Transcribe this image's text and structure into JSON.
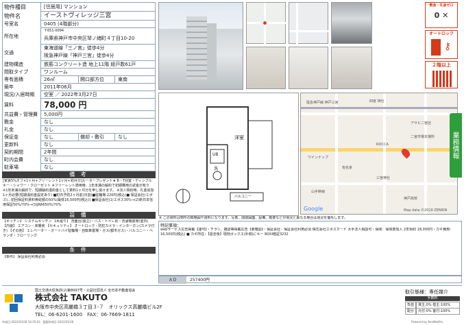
{
  "table": [
    {
      "label": "物件種目",
      "value": "[住居用] マンション"
    },
    {
      "label": "物件名",
      "value": "イーストヴィレッジ三宮"
    },
    {
      "label": "号室名",
      "value": "0405 (4階部分)"
    },
    {
      "label": "所在地",
      "value": "兵庫県神戸市中央区琴ノ緒町４丁目10-20",
      "postal": "〒651-0094"
    },
    {
      "label": "交通",
      "value": "東海道線「三ノ宮」徒歩4分",
      "value2": "阪急神戸線「神戸三宮」徒歩4分"
    },
    {
      "label": "建物構造",
      "value": "鉄筋コンクリート造 地上11階 総戸数61戸"
    },
    {
      "label": "間取タイプ",
      "value": "ワンルーム"
    },
    {
      "label": "専有面積",
      "value": "26㎡",
      "label2": "開口部方位",
      "value2": "東南"
    },
    {
      "label": "築年",
      "value": "2011年06月"
    },
    {
      "label": "現況/入居時期",
      "value": "空室 ／ 2022年3月27日"
    },
    {
      "label": "賃料",
      "value": "78,000 円"
    },
    {
      "label": "共益費・管理費",
      "value": "5,000円"
    },
    {
      "label": "敷金",
      "value": "なし"
    },
    {
      "label": "礼金",
      "value": "なし"
    },
    {
      "label": "保証金",
      "value": "なし",
      "label2": "償却・敷引",
      "value2": "なし"
    },
    {
      "label": "更新料",
      "value": "なし"
    },
    {
      "label": "契約期間",
      "value": "2年間"
    },
    {
      "label": "町内会費",
      "value": "なし"
    },
    {
      "label": "駐車場",
      "value": "なし"
    }
  ],
  "remarks_title": "備 考",
  "remarks": "[家賃5%オフ×1ヶ月+フリーレント1ヶ月+初月分]ルータープレゼント★ B・T別室・ディンプルキー・シャワー・クローゼット ※フリーレント適用時、1年未満の解約で初期費用の返金が有り ※1年未満の解約で、短期解約違約金として賃料1ヶ月分を申し受けます。 ※法人契約時、礼金追加1ヶ月必要(短期違約金設定あり) ■町内予防2ヶ月前(日割)■駐輪場:220円(税込)■ 保証会社(エポス)…初回保証料賃料等総額の50%(最低16,500円(税込)) ■保証会社(1)エポス30%→(2)新日本信用保証50%/70%→(3)JRA650%/70%",
  "facilities_title": "設 備",
  "facilities": "【キッチン】 システムキッチン 【水廻り】 洗面台(独立)・バス・トイレ別・洗濯機置場(室内) 【内装】 エアコン・床暖房 【セキュリティ】 オートロック・防犯カメラ・インターホン(カメラ付き) 【その他】 エレベーター・オートバイ駐輪場・自転車置場・ガス(都市ガス)・バルコニー・ベランダ・フローリング",
  "conditions_title": "条 件",
  "conditions": "【条件】 保証会社利用必須",
  "map_caption": "※ この資料は物件の概略図や資料になります。写真、間取図面、設備、概要などが現況と異なる場合は現況を優先します。",
  "floorplan_labels": {
    "room": "洋室",
    "ub": "UB",
    "wc": "洗",
    "balcony": "バルコニー"
  },
  "map_labels": [
    "阪急神戸線 神戸三宮",
    "四宮 神社",
    "ROCCA",
    "アサヒ二宮店",
    "二宮市場本場所",
    "ワインナップ",
    "有名家",
    "山手幹線",
    "三宮神社",
    "神戸高校",
    "Google",
    "Map data ©2019 ZENRIN"
  ],
  "side_tab": "業務情報",
  "badges": {
    "pets": "敷金・礼金ゼロ",
    "autolock": "オートロック",
    "floor": "２階以上"
  },
  "notes_title": "特記事項：",
  "notes": "webサービス広告掲載【諸可】・チラシ、雑誌等掲載広告【要確認】・保証会社：保証会社利用必須 株式会社エポスカード 大手法人相談可・保険：保険要加入 2年契約 18,000円・カギ費用：16,500円(税込) ■ カギ所在：【退去後】現地ボックス(外側)にキー BOXI暗証3232",
  "ad_label": "ＡＤ",
  "ad_value": "257400円",
  "company": {
    "license": "国土交通大臣免許(2)第8997号・公益社団法人 全日本不動産協会",
    "name": "株式会社 TAKUTO",
    "address": "大阪市中央区高麗橋３丁目３-７　オリックス高麗橋ビル2F",
    "tel": "TEL：06-6201-1600　FAX：06-7669-1811"
  },
  "transaction": {
    "title": "取引態様：専任媒介",
    "fee_label": "手数料",
    "rows": [
      {
        "k": "負担",
        "v": "貸主:0%  借主:100%"
      },
      {
        "k": "配分",
        "v": "元付:0%  客付:100%"
      }
    ]
  },
  "footer_left": "作成日:2022/03/28 16:35:03　図面作成日:2022/03/28",
  "footer_right": "Powered by RealNetPro"
}
